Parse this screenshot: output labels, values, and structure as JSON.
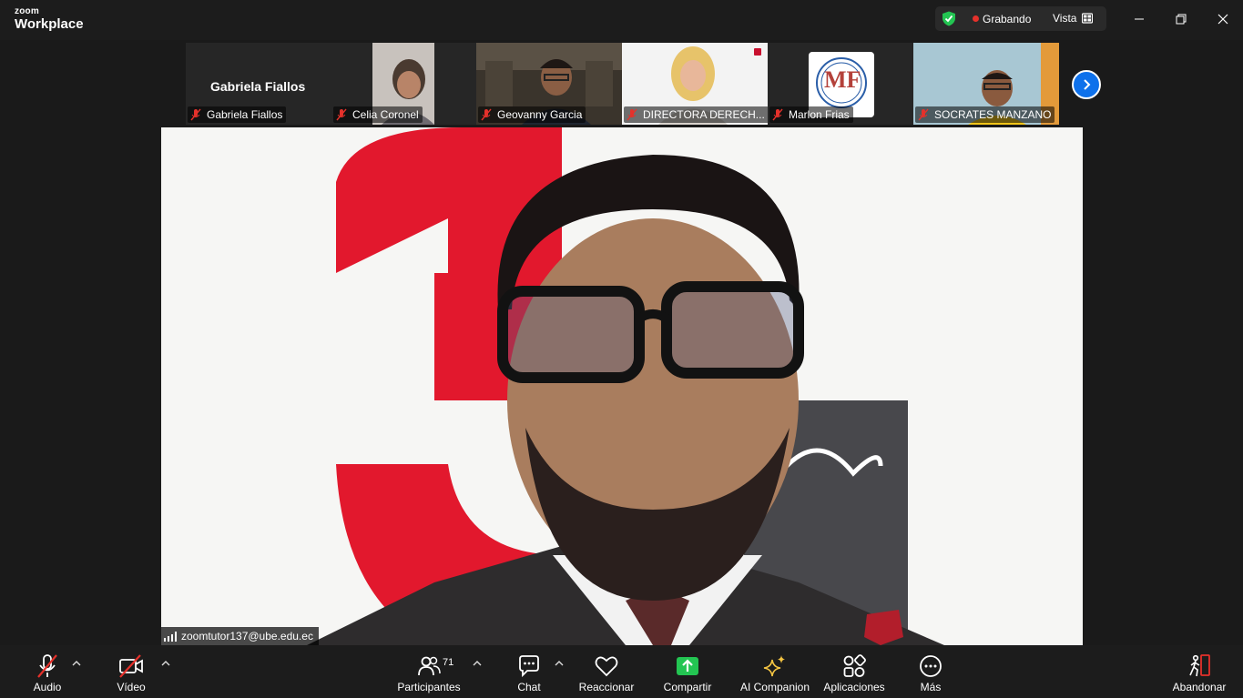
{
  "app": {
    "brand_small": "zoom",
    "brand_big": "Workplace"
  },
  "titlebar": {
    "recording_label": "Grabando",
    "view_label": "Vista",
    "recording_color": "#e5312b",
    "shield_color": "#23c552"
  },
  "gallery": {
    "tiles": [
      {
        "display_name": "Gabriela Fiallos",
        "label": "Gabriela Fiallos",
        "muted": true
      },
      {
        "label": "Celia Coronel",
        "muted": true
      },
      {
        "label": "Geovanny Garcia",
        "muted": true
      },
      {
        "label": "DIRECTORA DERECH...",
        "muted": true
      },
      {
        "label": "Marlon Frias",
        "muted": true,
        "logo_text": "MF"
      },
      {
        "label": "SOCRATES MANZANO",
        "muted": true
      }
    ],
    "next_icon": "chevron-right-icon"
  },
  "stage": {
    "speaker_label": "zoomtutor137@ube.edu.ec"
  },
  "toolbar": {
    "audio": "Audio",
    "video": "Vídeo",
    "participants": "Participantes",
    "participants_count": "71",
    "chat": "Chat",
    "react": "Reaccionar",
    "share": "Compartir",
    "ai": "AI Companion",
    "apps": "Aplicaciones",
    "more": "Más",
    "leave": "Abandonar",
    "share_color": "#23c552",
    "leave_color": "#e5312b",
    "mute_color": "#e5312b"
  }
}
